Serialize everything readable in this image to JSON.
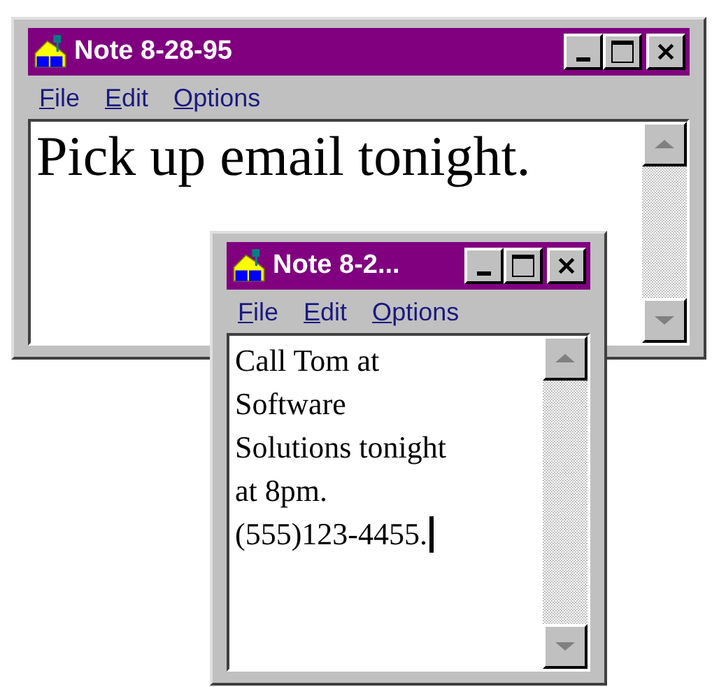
{
  "windows": [
    {
      "title": "Note 8-28-95",
      "menu": [
        "File",
        "Edit",
        "Options"
      ],
      "lines": [
        "Pick up email tonight."
      ],
      "cursor": false
    },
    {
      "title": "Note 8-2...",
      "menu": [
        "File",
        "Edit",
        "Options"
      ],
      "lines": [
        "Call Tom at",
        "Software",
        "Solutions tonight",
        "at 8pm.",
        "(555)123-4455."
      ],
      "cursor": true
    }
  ]
}
